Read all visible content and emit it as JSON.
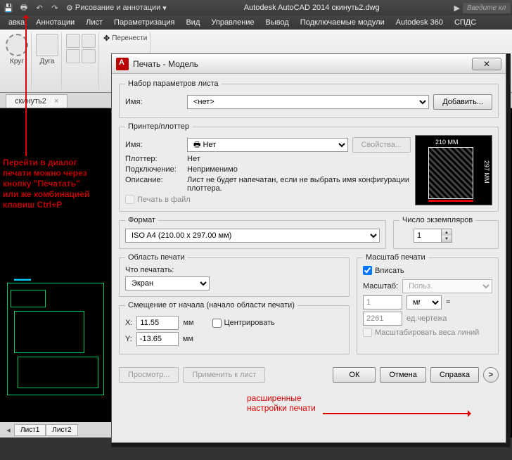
{
  "qat": {
    "workspace": "Рисование и аннотации",
    "app_title": "Autodesk AutoCAD 2014    скинуть2.dwg",
    "search_hint": "Введите кл"
  },
  "menu": [
    "авка",
    "Аннотации",
    "Лист",
    "Параметризация",
    "Вид",
    "Управление",
    "Вывод",
    "Подключаемые модули",
    "Autodesk 360",
    "СПДС"
  ],
  "ribbon": {
    "circle": "Круг",
    "arc": "Дуга",
    "move": "Перенести"
  },
  "doc_tab": "скинуть2",
  "hint_left": "Перейти в диалог\nпечати можно через\nкнопку \"Печатать\"\nили же комбинацией\nклавиш Ctrl+P",
  "layout_tabs": [
    "Лист1",
    "Лист2"
  ],
  "dlg": {
    "title": "Печать - Модель",
    "page_setup": "Набор параметров листа",
    "name_lbl": "Имя:",
    "name_val": "<нет>",
    "add_btn": "Добавить...",
    "printer_group": "Принтер/плоттер",
    "printer_name_lbl": "Имя:",
    "printer_val": "Нет",
    "props_btn": "Свойства...",
    "plotter_lbl": "Плоттер:",
    "plotter_val": "Нет",
    "conn_lbl": "Подключение:",
    "conn_val": "Неприменимо",
    "desc_lbl": "Описание:",
    "desc_val": "Лист не будет напечатан, если не выбрать имя конфигурации плоттера.",
    "to_file": "Печать в файл",
    "preview_w": "210 MM",
    "preview_h": "297 MM",
    "format_lbl": "Формат",
    "format_val": "ISO A4 (210.00 x 297.00 мм)",
    "copies_lbl": "Число экземпляров",
    "copies_val": "1",
    "area_group": "Область печати",
    "what_lbl": "Что печатать:",
    "what_val": "Экран",
    "offset_group": "Смещение от начала (начало области печати)",
    "x_lbl": "X:",
    "x_val": "11.55",
    "y_lbl": "Y:",
    "y_val": "-13.65",
    "mm": "мм",
    "center": "Центрировать",
    "scale_group": "Масштаб печати",
    "fit": "Вписать",
    "scale_lbl": "Масштаб:",
    "scale_val": "Польз.",
    "unit1_val": "1",
    "unit1_mm": "мм",
    "eq": "=",
    "unit2_val": "2261",
    "unit2_du": "ед.чертежа",
    "scale_lw": "Масштабировать веса линий",
    "preview_btn": "Просмотр...",
    "apply_btn": "Применить к лист",
    "ok": "ОК",
    "cancel": "Отмена",
    "help": "Справка",
    "expand": ">",
    "hint_right": "расширенные\nнастройки печати"
  }
}
